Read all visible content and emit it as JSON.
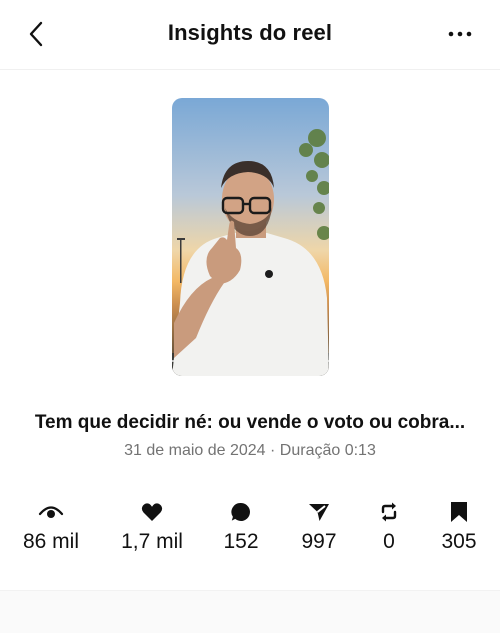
{
  "header": {
    "title": "Insights do reel",
    "back_icon": "chevron-left-icon",
    "more_icon": "more-horizontal-icon"
  },
  "reel": {
    "caption": "Tem que decidir né: ou vende o voto ou cobra...",
    "meta": "31 de maio de 2024 · Duração 0:13"
  },
  "stats": [
    {
      "icon": "eye-icon",
      "value": "86 mil"
    },
    {
      "icon": "heart-icon",
      "value": "1,7 mil"
    },
    {
      "icon": "comment-icon",
      "value": "152"
    },
    {
      "icon": "share-icon",
      "value": "997"
    },
    {
      "icon": "repost-icon",
      "value": "0"
    },
    {
      "icon": "bookmark-icon",
      "value": "305"
    }
  ],
  "colors": {
    "text": "#111111",
    "secondary_text": "#737373",
    "background": "#ffffff"
  }
}
